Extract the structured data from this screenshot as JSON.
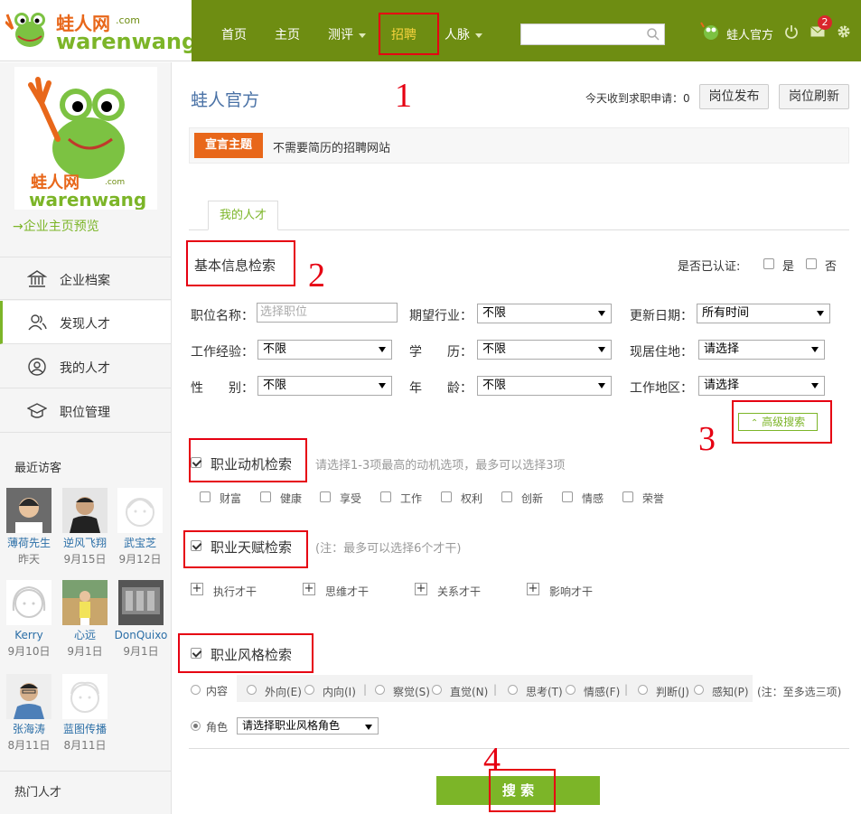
{
  "nav": {
    "logo_text": "蛙人网",
    "logo_sub": "warenwang",
    "logo_com": ".com",
    "items": [
      "首页",
      "主页",
      "测评",
      "招聘",
      "人脉"
    ],
    "user_name": "蛙人官方",
    "notification_count": "2"
  },
  "sidebar": {
    "preview_link": "→企业主页预览",
    "menu": [
      "企业档案",
      "发现人才",
      "我的人才",
      "职位管理"
    ],
    "recent_visitors_title": "最近访客",
    "visitors": [
      {
        "name": "薄荷先生",
        "date": "昨天"
      },
      {
        "name": "逆风飞翔",
        "date": "9月15日"
      },
      {
        "name": "武宝芝",
        "date": "9月12日"
      },
      {
        "name": "Kerry",
        "date": "9月10日"
      },
      {
        "name": "心远",
        "date": "9月1日"
      },
      {
        "name": "DonQuixo",
        "date": "9月1日"
      },
      {
        "name": "张海涛",
        "date": "8月11日"
      },
      {
        "name": "蓝图传播",
        "date": "8月11日"
      }
    ],
    "hot_talent_title": "热门人才"
  },
  "header": {
    "company": "蛙人官方",
    "applications_text": "今天收到求职申请：0",
    "publish_btn": "岗位发布",
    "refresh_btn": "岗位刷新",
    "motto_tag": "宣言主题",
    "motto_text": "不需要简历的招聘网站"
  },
  "tab": {
    "label": "我的人才"
  },
  "basic": {
    "title": "基本信息检索",
    "verified_label": "是否已认证:",
    "yes": "是",
    "no": "否",
    "job_name_label": "职位名称：",
    "job_name_placeholder": "选择职位",
    "industry_label": "期望行业：",
    "industry_value": "不限",
    "update_label": "更新日期：",
    "update_value": "所有时间",
    "exp_label": "工作经验：",
    "exp_value": "不限",
    "edu_label": "学　　历：",
    "edu_value": "不限",
    "residence_label": "现居住地：",
    "residence_value": "请选择",
    "gender_label": "性　　别：",
    "gender_value": "不限",
    "age_label": "年　　龄：",
    "age_value": "不限",
    "work_area_label": "工作地区：",
    "work_area_value": "请选择",
    "advanced_btn": "高级搜索"
  },
  "motivation": {
    "title": "职业动机检索",
    "hint": "请选择1-3项最高的动机选项，最多可以选择3项",
    "options": [
      "财富",
      "健康",
      "享受",
      "工作",
      "权利",
      "创新",
      "情感",
      "荣誉"
    ]
  },
  "talent": {
    "title": "职业天赋检索",
    "hint": "(注：最多可以选择6个才干)",
    "options": [
      "执行才干",
      "思维才干",
      "关系才干",
      "影响才干"
    ]
  },
  "style": {
    "title": "职业风格检索",
    "content_label": "内容",
    "options": [
      "外向(E)",
      "内向(I)",
      "察觉(S)",
      "直觉(N)",
      "思考(T)",
      "情感(F)",
      "判断(J)",
      "感知(P)"
    ],
    "separator": "|",
    "note": "(注：至多选三项)",
    "role_label": "角色",
    "role_value": "请选择职业风格角色"
  },
  "search_btn": "搜 索",
  "annotations": [
    "1",
    "2",
    "3",
    "4"
  ],
  "colors": {
    "brand_green": "#6e8d12",
    "accent_green": "#7cb528",
    "orange": "#e8671a",
    "red": "#e60012"
  }
}
